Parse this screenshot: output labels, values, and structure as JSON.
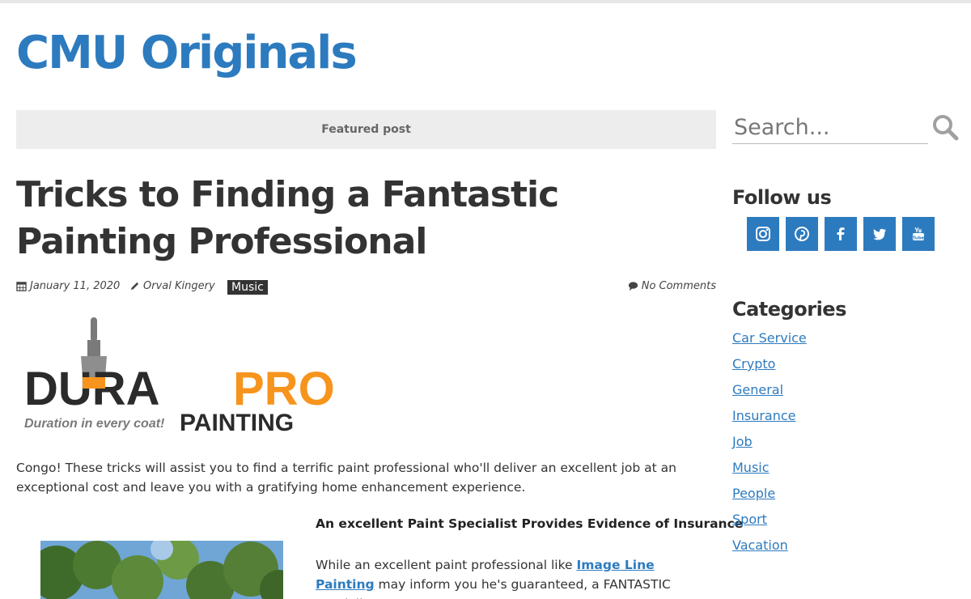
{
  "site": {
    "title": "CMU Originals"
  },
  "featured": {
    "label": "Featured post"
  },
  "post": {
    "title": "Tricks to Finding a Fantastic Painting Professional",
    "date": "January 11, 2020",
    "author": "Orval Kingery",
    "tag": "Music",
    "comments": "No Comments",
    "logo": {
      "word_left": "DURA",
      "word_right": "PRO",
      "tagline": "Duration in every coat!",
      "sub": "PAINTING",
      "colors": {
        "dark": "#2b2b2b",
        "orange": "#f7941d",
        "gray": "#7a7a7a"
      }
    },
    "intro": "Congo! These tricks will assist you to find a terrific paint professional who'll deliver an excellent job at an exceptional cost and leave you with a gratifying home enhancement experience.",
    "section_heading": "An excellent Paint Specialist Provides Evidence of Insurance",
    "para_before_link": "While an excellent paint professional like ",
    "para_link": "Image Line Painting",
    "para_after_link": " may inform you he's guaranteed, a FANTASTIC specialist"
  },
  "sidebar": {
    "search_placeholder": "Search...",
    "follow_title": "Follow us",
    "social": [
      {
        "icon": "instagram-icon"
      },
      {
        "icon": "pinterest-icon"
      },
      {
        "icon": "facebook-icon"
      },
      {
        "icon": "twitter-icon"
      },
      {
        "icon": "youtube-icon"
      }
    ],
    "categories_title": "Categories",
    "categories": [
      "Car Service",
      "Crypto",
      "General",
      "Insurance",
      "Job",
      "Music",
      "People",
      "Sport",
      "Vacation"
    ]
  },
  "colors": {
    "accent": "#2d7bbf",
    "text": "#333333",
    "featured_bg": "#ededed"
  }
}
